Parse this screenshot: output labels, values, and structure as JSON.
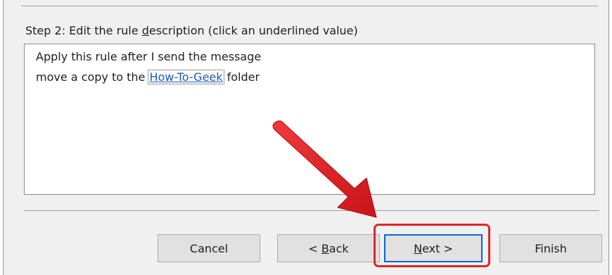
{
  "dialog": {
    "step_label_prefix": "Step 2: Edit the rule ",
    "step_label_mnemonic": "d",
    "step_label_suffix": "escription (click an underlined value)"
  },
  "rule_description": {
    "line1": "Apply this rule after I send the message",
    "line2_prefix": "move a copy to the ",
    "line2_link": "How-To-Geek",
    "line2_suffix": " folder"
  },
  "buttons": {
    "cancel": {
      "label": "Cancel"
    },
    "back": {
      "prefix": "< ",
      "mnemonic": "B",
      "suffix": "ack"
    },
    "next": {
      "mnemonic": "N",
      "suffix": "ext >"
    },
    "finish": {
      "label": "Finish"
    }
  },
  "annotation": {
    "color": "#e0262a",
    "highlight_target": "next-button",
    "arrow_icon": "red-arrow-icon"
  },
  "colors": {
    "panel_bg": "#f0f0f0",
    "link": "#1a5fb4",
    "focus_border": "#0a64d8",
    "annotation_red": "#e0262a"
  }
}
